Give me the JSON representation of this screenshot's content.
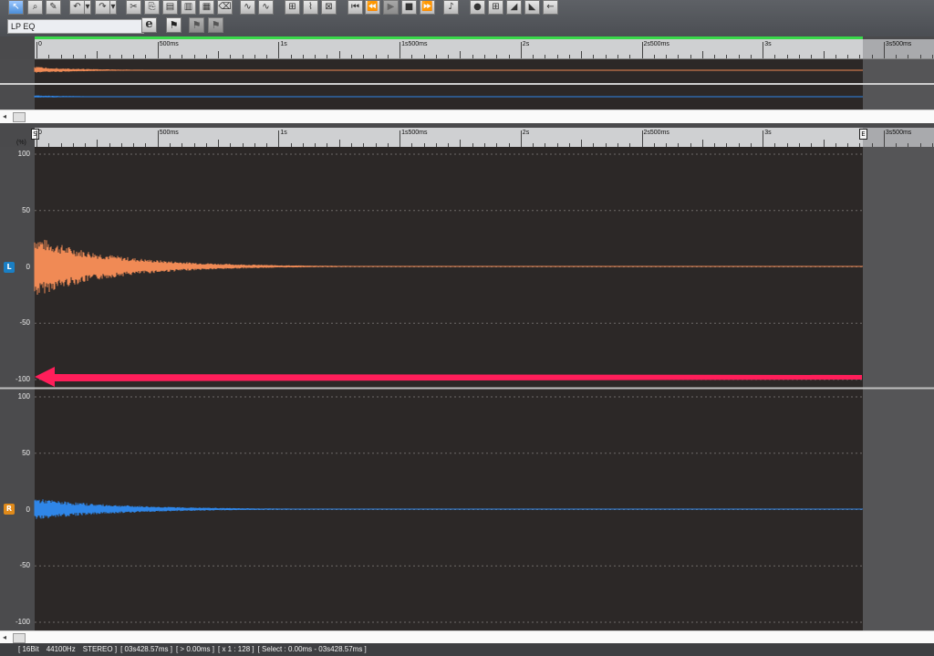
{
  "toolbar": {
    "buttons": [
      "select-tool",
      "zoom-tool",
      "pencil-tool",
      "undo",
      "undo-dropdown",
      "redo",
      "redo-dropdown",
      "cut",
      "copy",
      "paste",
      "paste-insert",
      "paste-mix",
      "eraser",
      "fade-in",
      "fade-out",
      "normalize",
      "envelope",
      "crossfade",
      "go-start",
      "rewind",
      "play",
      "stop",
      "fast-forward",
      "metronome",
      "record",
      "loop",
      "volume-down",
      "volume-up",
      "mute"
    ]
  },
  "preset": {
    "value": "LP EQ"
  },
  "edit_button": "e",
  "ruler": {
    "labels": [
      "0",
      "500ms",
      "1s",
      "1s500ms",
      "2s",
      "2s500ms",
      "3s",
      "3s500ms"
    ],
    "start_marker": "S",
    "end_marker": "E"
  },
  "axis": {
    "unit": "(%)",
    "ticks": [
      "100",
      "50",
      "0",
      "-50",
      "-100"
    ]
  },
  "channels": {
    "left": {
      "badge": "L",
      "color": "#f08a55"
    },
    "right": {
      "badge": "R",
      "color": "#2f86e8"
    }
  },
  "annotation": {
    "color": "#ff1e5a"
  },
  "status": {
    "bit_depth": "[ 16Bit",
    "sample_rate": "44100Hz",
    "channels": "STEREO ]",
    "duration": "[ 03s428.57ms ]",
    "position": "[ > 0.00ms ]",
    "zoom": "[ x 1 : 128 ]",
    "selection": "[ Select : 0.00ms - 03s428.57ms ]"
  }
}
